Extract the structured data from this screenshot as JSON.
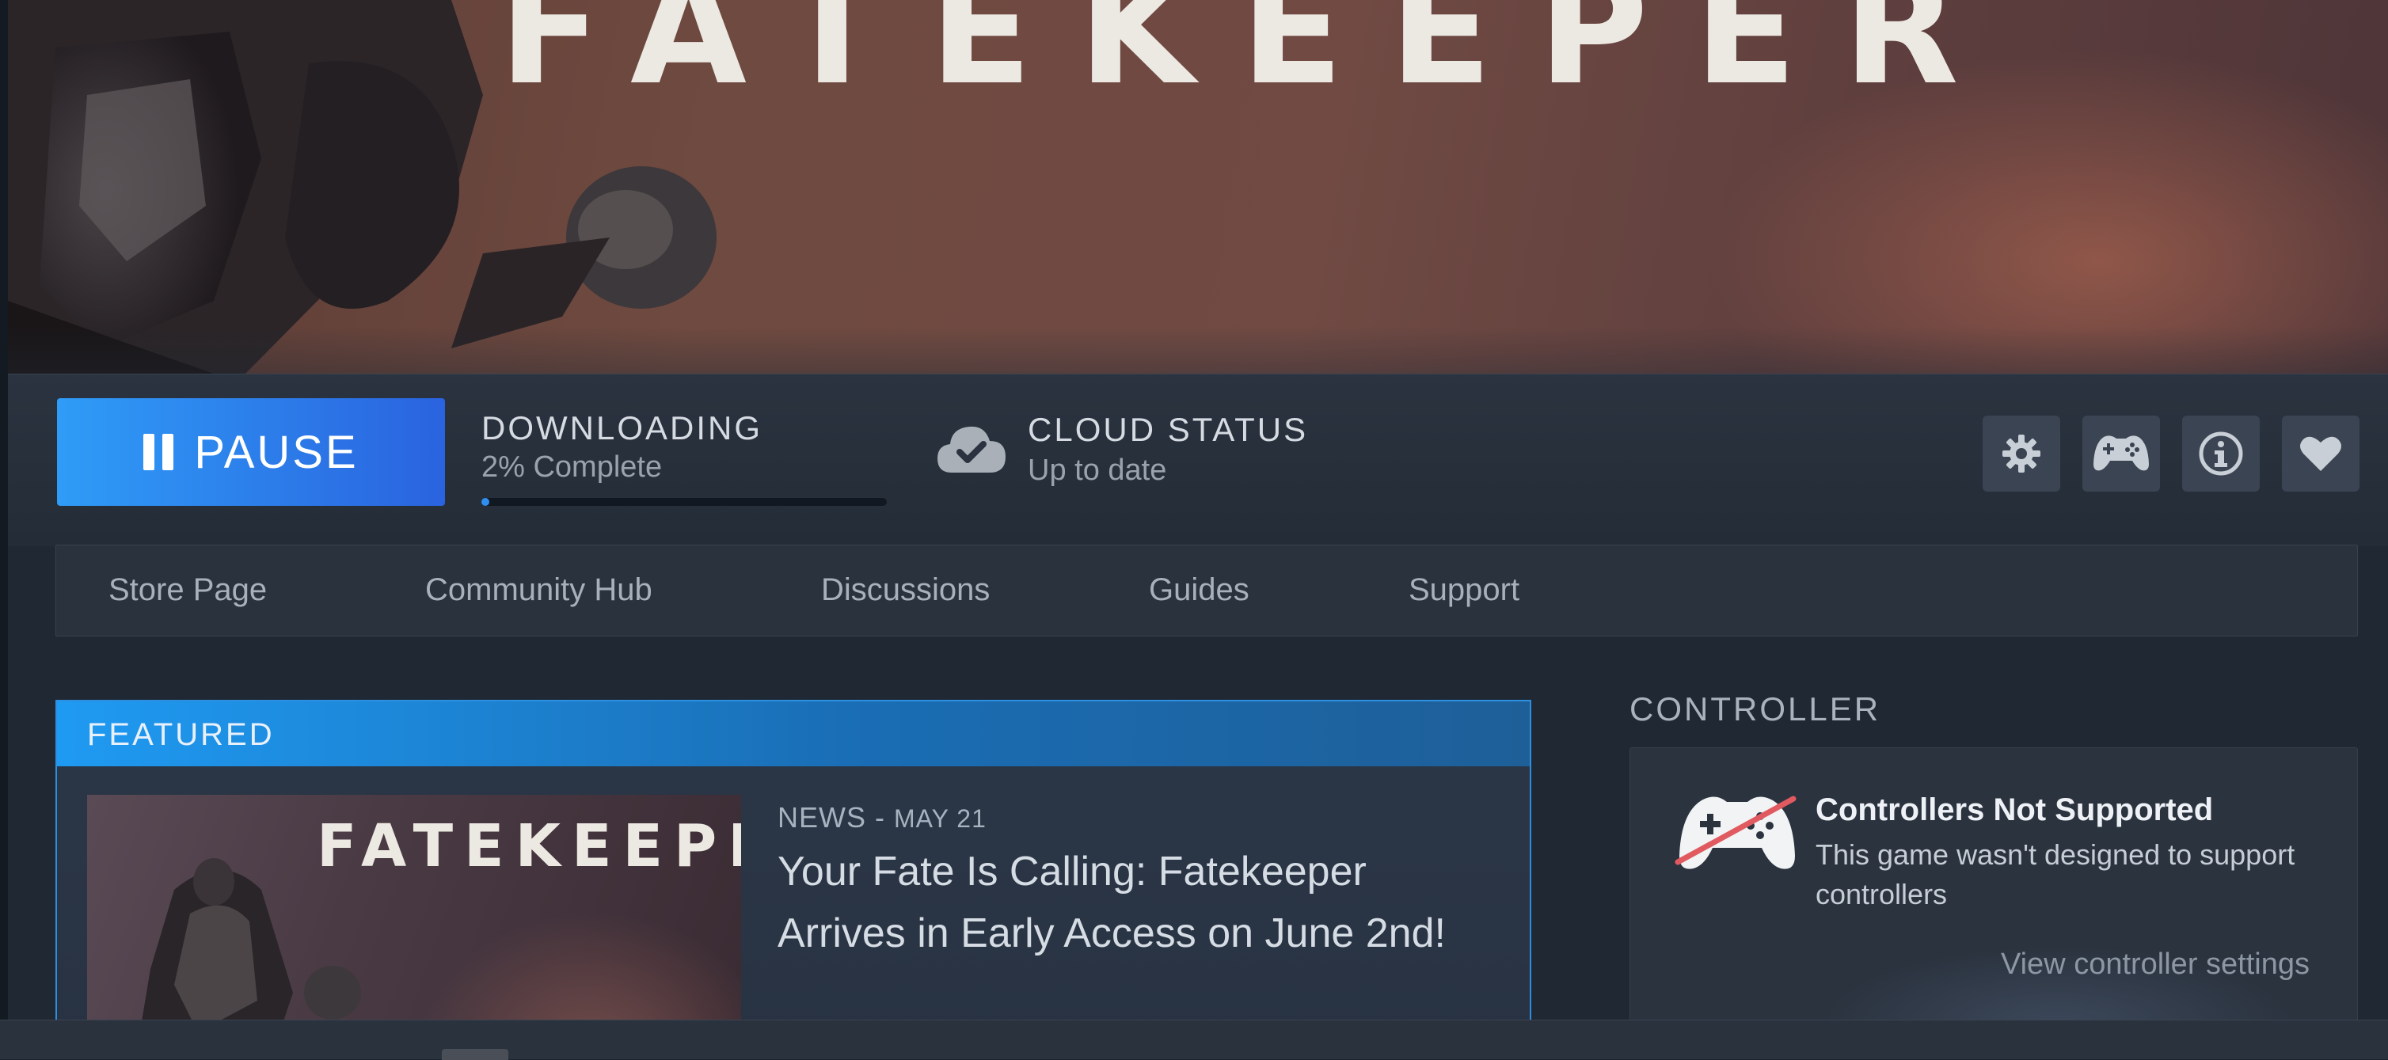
{
  "hero": {
    "title": "FATEKEEPER"
  },
  "action_bar": {
    "pause_label": "PAUSE",
    "download": {
      "title": "DOWNLOADING",
      "status": "2% Complete",
      "progress_percent": 2
    },
    "cloud": {
      "title": "CLOUD STATUS",
      "status": "Up to date"
    },
    "icons": [
      "gear-icon",
      "controller-icon",
      "info-icon",
      "heart-icon"
    ]
  },
  "nav": {
    "items": [
      "Store Page",
      "Community Hub",
      "Discussions",
      "Guides",
      "Support"
    ]
  },
  "featured": {
    "label": "FEATURED",
    "thumb_title": "FATEKEEPER",
    "news_type": "NEWS",
    "news_date": "MAY 21",
    "headline": "Your Fate Is Calling: Fatekeeper Arrives in Early Access on June 2nd!"
  },
  "controller": {
    "section_label": "CONTROLLER",
    "title": "Controllers Not Supported",
    "description": "This game wasn't designed to support controllers",
    "link": "View controller settings"
  },
  "colors": {
    "accent_blue": "#2f9cf7",
    "accent_blue_dark": "#2a63df",
    "featured_border": "#2d8fe0",
    "background": "#202833"
  }
}
